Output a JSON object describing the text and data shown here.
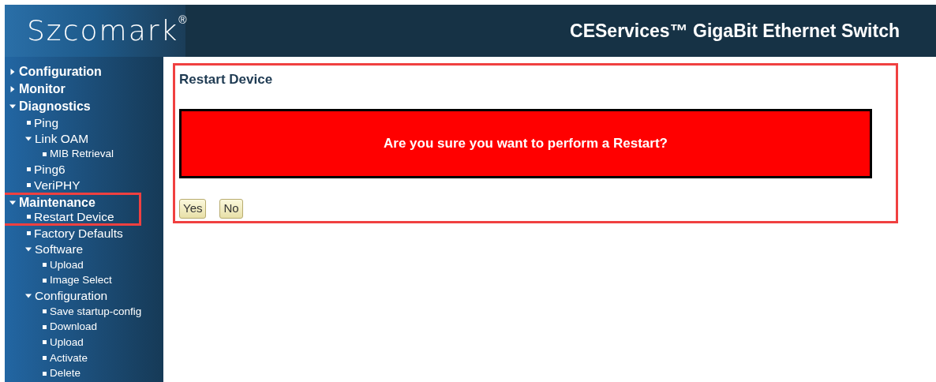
{
  "header": {
    "logo": "Szcomark",
    "logo_mark": "®",
    "title": "CEServices™ GigaBit Ethernet Switch"
  },
  "sidebar": {
    "items": [
      {
        "label": "Configuration",
        "expanded": false,
        "highlighted": false
      },
      {
        "label": "Monitor",
        "expanded": false,
        "highlighted": false
      },
      {
        "label": "Diagnostics",
        "expanded": true,
        "highlighted": false,
        "children": [
          {
            "label": "Ping",
            "highlighted": false
          },
          {
            "label": "Link OAM",
            "expanded": true,
            "highlighted": false,
            "children": [
              {
                "label": "MIB Retrieval",
                "highlighted": false
              }
            ]
          },
          {
            "label": "Ping6",
            "highlighted": false
          },
          {
            "label": "VeriPHY",
            "highlighted": false
          }
        ]
      },
      {
        "label": "Maintenance",
        "expanded": true,
        "highlighted": true,
        "children": [
          {
            "label": "Restart Device",
            "highlighted": true
          },
          {
            "label": "Factory Defaults",
            "highlighted": false
          },
          {
            "label": "Software",
            "expanded": true,
            "highlighted": false,
            "children": [
              {
                "label": "Upload",
                "highlighted": false
              },
              {
                "label": "Image Select",
                "highlighted": false
              }
            ]
          },
          {
            "label": "Configuration",
            "expanded": true,
            "highlighted": false,
            "children": [
              {
                "label": "Save startup-config",
                "highlighted": false
              },
              {
                "label": "Download",
                "highlighted": false
              },
              {
                "label": "Upload",
                "highlighted": false
              },
              {
                "label": "Activate",
                "highlighted": false
              },
              {
                "label": "Delete",
                "highlighted": false
              }
            ]
          }
        ]
      }
    ]
  },
  "main": {
    "title": "Restart Device",
    "highlighted": true,
    "warning": "Are you sure you want to perform a Restart?",
    "buttons": [
      "Yes",
      "No"
    ]
  }
}
